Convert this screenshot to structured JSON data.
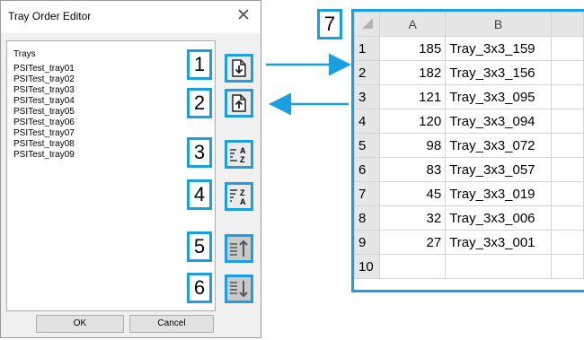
{
  "dialog": {
    "title": "Tray Order Editor",
    "close_label": "✕",
    "list_header": "Trays",
    "items": [
      "PSITest_tray01",
      "PSITest_tray02",
      "PSITest_tray03",
      "PSITest_tray04",
      "PSITest_tray05",
      "PSITest_tray06",
      "PSITest_tray07",
      "PSITest_tray08",
      "PSITest_tray09"
    ],
    "ok_label": "OK",
    "cancel_label": "Cancel"
  },
  "callouts": [
    "1",
    "2",
    "3",
    "4",
    "5",
    "6",
    "7"
  ],
  "tool_icons": [
    "import-icon",
    "export-icon",
    "sort-ascending-icon",
    "sort-descending-icon",
    "move-up-icon",
    "move-down-icon"
  ],
  "sheet": {
    "columns": [
      "A",
      "B"
    ],
    "rows": [
      {
        "n": "1",
        "a": "185",
        "b": "Tray_3x3_159"
      },
      {
        "n": "2",
        "a": "182",
        "b": "Tray_3x3_156"
      },
      {
        "n": "3",
        "a": "121",
        "b": "Tray_3x3_095"
      },
      {
        "n": "4",
        "a": "120",
        "b": "Tray_3x3_094"
      },
      {
        "n": "5",
        "a": "98",
        "b": "Tray_3x3_072"
      },
      {
        "n": "6",
        "a": "83",
        "b": "Tray_3x3_057"
      },
      {
        "n": "7",
        "a": "45",
        "b": "Tray_3x3_019"
      },
      {
        "n": "8",
        "a": "32",
        "b": "Tray_3x3_006"
      },
      {
        "n": "9",
        "a": "27",
        "b": "Tray_3x3_001"
      },
      {
        "n": "10",
        "a": "",
        "b": ""
      }
    ]
  },
  "colors": {
    "accent": "#1aa0e0"
  }
}
